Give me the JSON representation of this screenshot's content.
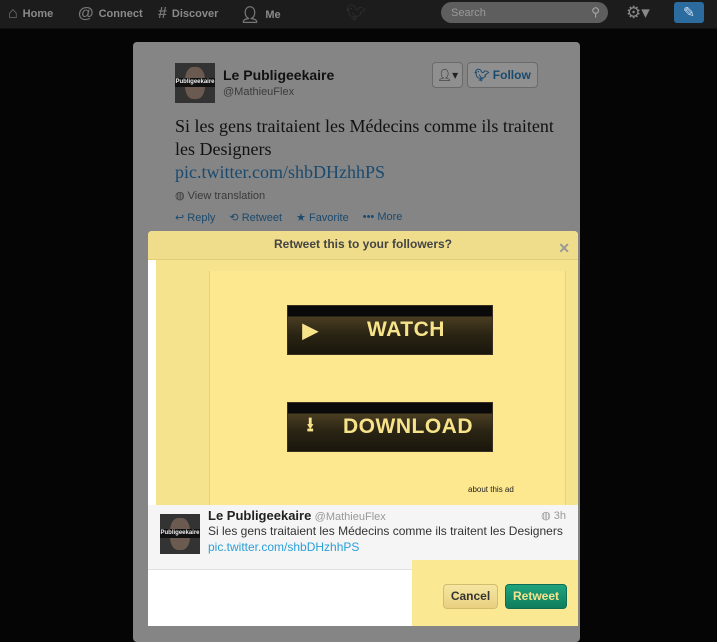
{
  "nav": {
    "items": [
      {
        "label": "Home",
        "icon": "home-icon"
      },
      {
        "label": "Connect",
        "icon": "at-icon"
      },
      {
        "label": "Discover",
        "icon": "hash-icon"
      },
      {
        "label": "Me",
        "icon": "person-icon"
      }
    ],
    "search_placeholder": "Search"
  },
  "tweet": {
    "name": "Le Publigeekaire",
    "handle": "@MathieuFlex",
    "text": "Si les gens traitaient les Médecins comme ils traitent les Designers",
    "link": "pic.twitter.com/shbDHzhhPS",
    "view_translation": "View translation",
    "follow": "Follow",
    "actions": [
      "Reply",
      "Retweet",
      "Favorite",
      "More"
    ],
    "time": "3h",
    "avatar_text": "Publigeekaire"
  },
  "modal": {
    "title": "Retweet this to your followers?",
    "ad": {
      "watch": "WATCH",
      "download": "DOWNLOAD",
      "about": "about this ad"
    },
    "cancel": "Cancel",
    "retweet": "Retweet"
  },
  "colors": {
    "ad_yellow": "#fde890",
    "retweet_green": "#1a9470",
    "link_blue": "#2a9fd8"
  }
}
